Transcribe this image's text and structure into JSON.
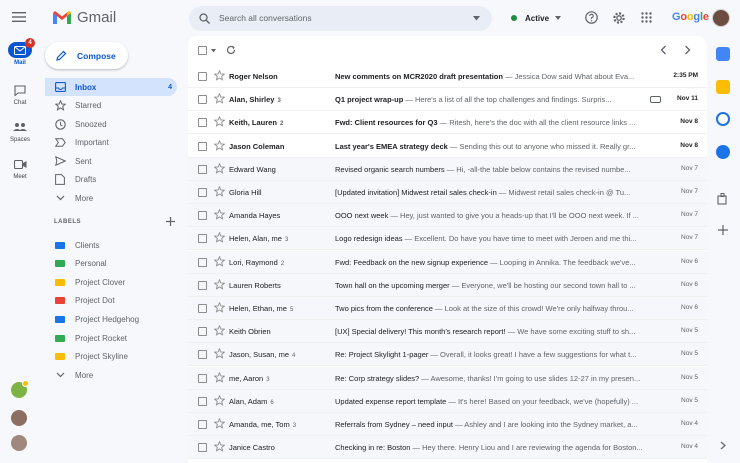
{
  "app": {
    "name": "Gmail"
  },
  "search": {
    "placeholder": "Search all conversations"
  },
  "status": {
    "label": "Active"
  },
  "google": {
    "letters": [
      {
        "t": "G",
        "c": "#4285f4"
      },
      {
        "t": "o",
        "c": "#ea4335"
      },
      {
        "t": "o",
        "c": "#fbbc05"
      },
      {
        "t": "g",
        "c": "#4285f4"
      },
      {
        "t": "l",
        "c": "#34a853"
      },
      {
        "t": "e",
        "c": "#ea4335"
      }
    ]
  },
  "rail": {
    "mail": "Mail",
    "mail_badge": "4",
    "chat": "Chat",
    "spaces": "Spaces",
    "meet": "Meet"
  },
  "compose": {
    "label": "Compose"
  },
  "nav": [
    {
      "label": "Inbox",
      "count": "4",
      "icon": "inbox-icon"
    },
    {
      "label": "Starred",
      "icon": "star-icon"
    },
    {
      "label": "Snoozed",
      "icon": "clock-icon"
    },
    {
      "label": "Important",
      "icon": "important-icon"
    },
    {
      "label": "Sent",
      "icon": "send-icon"
    },
    {
      "label": "Drafts",
      "icon": "draft-icon"
    },
    {
      "label": "More",
      "icon": "chevron-down-icon"
    }
  ],
  "labels_heading": "LABELS",
  "labels": [
    {
      "label": "Clients",
      "color": "#1a73e8"
    },
    {
      "label": "Personal",
      "color": "#34a853"
    },
    {
      "label": "Project Clover",
      "color": "#fbbc04"
    },
    {
      "label": "Project Dot",
      "color": "#ea4335"
    },
    {
      "label": "Project Hedgehog",
      "color": "#1a73e8"
    },
    {
      "label": "Project Rocket",
      "color": "#34a853"
    },
    {
      "label": "Project Skyline",
      "color": "#fbbc04"
    }
  ],
  "labels_more": "More",
  "emails": [
    {
      "sender": "Roger Nelson",
      "n": "",
      "subject": "New comments on MCR2020 draft presentation",
      "snippet": " — Jessica Dow said What about Eva...",
      "date": "2:35 PM",
      "unread": true
    },
    {
      "sender": "Alan, Shirley",
      "n": "3",
      "subject": "Q1 project wrap-up",
      "snippet": " — Here's a list of all the top challenges and findings. Surpris...",
      "date": "Nov 11",
      "unread": true,
      "attach": true
    },
    {
      "sender": "Keith, Lauren",
      "n": "2",
      "subject": "Fwd: Client resources for Q3",
      "snippet": " — Ritesh, here's the doc with all the client resource links ...",
      "date": "Nov 8",
      "unread": true
    },
    {
      "sender": "Jason Coleman",
      "n": "",
      "subject": "Last year's EMEA strategy deck",
      "snippet": " — Sending this out to anyone who missed it. Really gr...",
      "date": "Nov 8",
      "unread": true
    },
    {
      "sender": "Edward Wang",
      "n": "",
      "subject": "Revised organic search numbers",
      "snippet": " — Hi, -all-the table below contains the revised numbe...",
      "date": "Nov 7",
      "unread": false
    },
    {
      "sender": "Gloria Hill",
      "n": "",
      "subject": "[Updated invitation] Midwest retail sales check-in",
      "snippet": " — Midwest retail sales check-in @ Tu...",
      "date": "Nov 7",
      "unread": false
    },
    {
      "sender": "Amanda Hayes",
      "n": "",
      "subject": "OOO next week",
      "snippet": " — Hey, just wanted to give you a heads-up that I'll be OOO next week. If ...",
      "date": "Nov 7",
      "unread": false
    },
    {
      "sender": "Helen, Alan, me",
      "n": "3",
      "subject": "Logo redesign ideas",
      "snippet": " — Excellent. Do have you have time to meet with Jeroen and me thi...",
      "date": "Nov 7",
      "unread": false
    },
    {
      "sender": "Lori, Raymond",
      "n": "2",
      "subject": "Fwd: Feedback on the new signup experience",
      "snippet": " — Looping in Annika. The feedback we've...",
      "date": "Nov 6",
      "unread": false
    },
    {
      "sender": "Lauren Roberts",
      "n": "",
      "subject": "Town hall on the upcoming merger",
      "snippet": " — Everyone, we'll be hosting our second town hall to ...",
      "date": "Nov 6",
      "unread": false
    },
    {
      "sender": "Helen, Ethan, me",
      "n": "5",
      "subject": "Two pics from the conference",
      "snippet": " — Look at the size of this crowd! We're only halfway throu...",
      "date": "Nov 6",
      "unread": false
    },
    {
      "sender": "Keith Obrien",
      "n": "",
      "subject": "[UX] Special delivery! This month's research report!",
      "snippet": " — We have some exciting stuff to sh...",
      "date": "Nov 5",
      "unread": false
    },
    {
      "sender": "Jason, Susan, me",
      "n": "4",
      "subject": "Re: Project Skylight 1-pager",
      "snippet": " — Overall, it looks great! I have a few suggestions for what t...",
      "date": "Nov 5",
      "unread": false
    },
    {
      "sender": "me, Aaron",
      "n": "3",
      "subject": "Re: Corp strategy slides?",
      "snippet": " — Awesome, thanks! I'm going to use slides 12-27 in my presen...",
      "date": "Nov 5",
      "unread": false
    },
    {
      "sender": "Alan, Adam",
      "n": "6",
      "subject": "Updated expense report template",
      "snippet": " — It's here! Based on your feedback, we've (hopefully) ...",
      "date": "Nov 5",
      "unread": false
    },
    {
      "sender": "Amanda, me, Tom",
      "n": "3",
      "subject": "Referrals from Sydney – need input",
      "snippet": " — Ashley and I are looking into the Sydney market, a...",
      "date": "Nov 4",
      "unread": false
    },
    {
      "sender": "Janice Castro",
      "n": "",
      "subject": "Checking in re: Boston",
      "snippet": " — Hey there. Henry Liou and I are reviewing the agenda for Boston...",
      "date": "Nov 4",
      "unread": false
    }
  ]
}
